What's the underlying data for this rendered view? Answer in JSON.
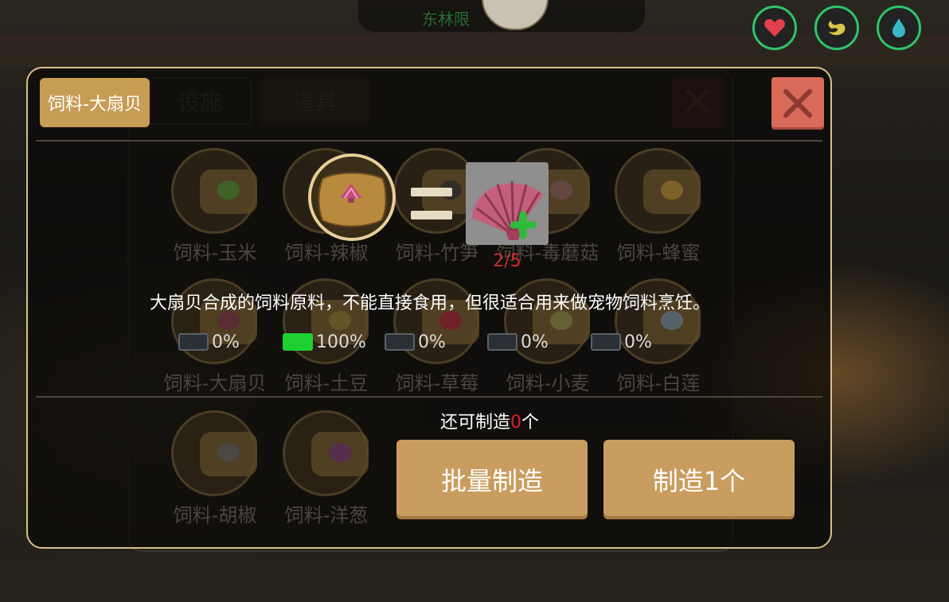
{
  "top_bar": {
    "banner_text": "东林限",
    "stats": [
      {
        "icon": "heart-icon",
        "color": "#e0404c"
      },
      {
        "icon": "stomach-icon",
        "color": "#d8c44a"
      },
      {
        "icon": "water-drop-icon",
        "color": "#3bb8c6"
      }
    ]
  },
  "background_window": {
    "tabs": [
      "设施",
      "道具"
    ]
  },
  "dialog": {
    "title": "饲料-大扇贝",
    "items": [
      {
        "name": "饲料-玉米",
        "glyph_color": "#3c6a2a"
      },
      {
        "name": "饲料-辣椒",
        "glyph_color": "#7a2a2a"
      },
      {
        "name": "饲料-竹笋",
        "glyph_color": "#2a2a2a"
      },
      {
        "name": "饲料-毒蘑菇",
        "glyph_color": "#6a4a4a"
      },
      {
        "name": "饲料-蜂蜜",
        "glyph_color": "#8a6a2a"
      },
      {
        "name": "饲料-大扇贝",
        "glyph_color": "#5a2a3a"
      },
      {
        "name": "饲料-土豆",
        "glyph_color": "#6a5a2a"
      },
      {
        "name": "饲料-草莓",
        "glyph_color": "#7a1a2a"
      },
      {
        "name": "饲料-小麦",
        "glyph_color": "#6a6a3a"
      },
      {
        "name": "饲料-白莲",
        "glyph_color": "#5a6a7a"
      },
      {
        "name": "饲料-胡椒",
        "glyph_color": "#4a4a4a"
      },
      {
        "name": "饲料-洋葱",
        "glyph_color": "#5a2a5a"
      }
    ],
    "recipe": {
      "ingredient_count": "2/5",
      "description": "大扇贝合成的饲料原料，不能直接食用，但很适合用来做宠物饲料烹饪。"
    },
    "progress": [
      {
        "pct": "0%",
        "value": 0
      },
      {
        "pct": "100%",
        "value": 1
      },
      {
        "pct": "0%",
        "value": 0
      },
      {
        "pct": "0%",
        "value": 0
      },
      {
        "pct": "0%",
        "value": 0
      }
    ],
    "remain_prefix": "还可制造",
    "remain_count": "0",
    "remain_suffix": "个",
    "batch_button": "批量制造",
    "make_one_button": "制造1个"
  }
}
